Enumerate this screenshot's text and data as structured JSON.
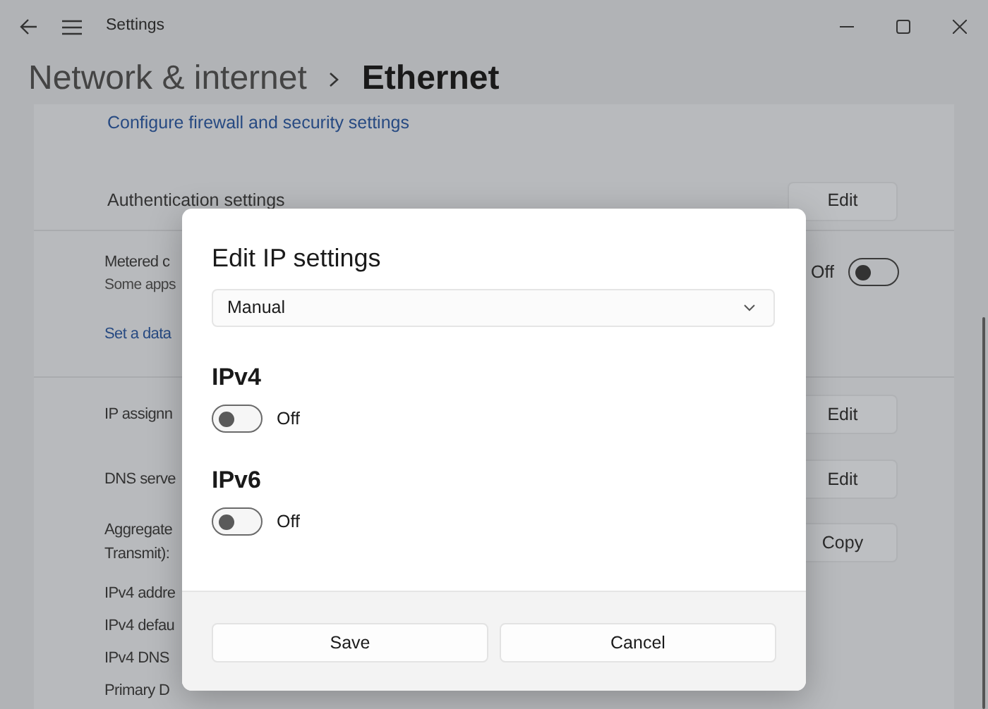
{
  "window": {
    "title": "Settings"
  },
  "breadcrumb": [
    {
      "label": "Network & internet",
      "selected": false
    },
    {
      "label": "Ethernet",
      "selected": true
    }
  ],
  "settings": [
    {
      "kind": "link",
      "label": "Configure firewall and security settings"
    },
    {
      "kind": "button",
      "lines": [
        "Authentication settings"
      ],
      "button": "Edit"
    },
    {
      "kind": "toggle",
      "lines": [
        "Metered c"
      ],
      "description": "Some apps",
      "state_label": "Off",
      "on": false
    },
    {
      "kind": "link",
      "label": "Set a data"
    },
    {
      "kind": "button",
      "lines": [
        "IP assignn"
      ],
      "button": "Edit"
    },
    {
      "kind": "button",
      "lines": [
        "DNS serve"
      ],
      "button": "Edit"
    },
    {
      "kind": "button",
      "lines": [
        "Aggregate",
        "Transmit):"
      ],
      "button": "Copy"
    },
    {
      "kind": "info",
      "lines": [
        "IPv4 addre"
      ]
    },
    {
      "kind": "info",
      "lines": [
        "IPv4 defau"
      ]
    },
    {
      "kind": "info",
      "lines": [
        "IPv4 DNS"
      ]
    },
    {
      "kind": "info",
      "lines": [
        "Primary D"
      ]
    }
  ],
  "dialog": {
    "title": "Edit IP settings",
    "dropdown": {
      "value": "Manual"
    },
    "sections": [
      {
        "heading": "IPv4",
        "state_label": "Off",
        "on": false
      },
      {
        "heading": "IPv6",
        "state_label": "Off",
        "on": false
      }
    ],
    "buttons": [
      "Save",
      "Cancel"
    ]
  }
}
